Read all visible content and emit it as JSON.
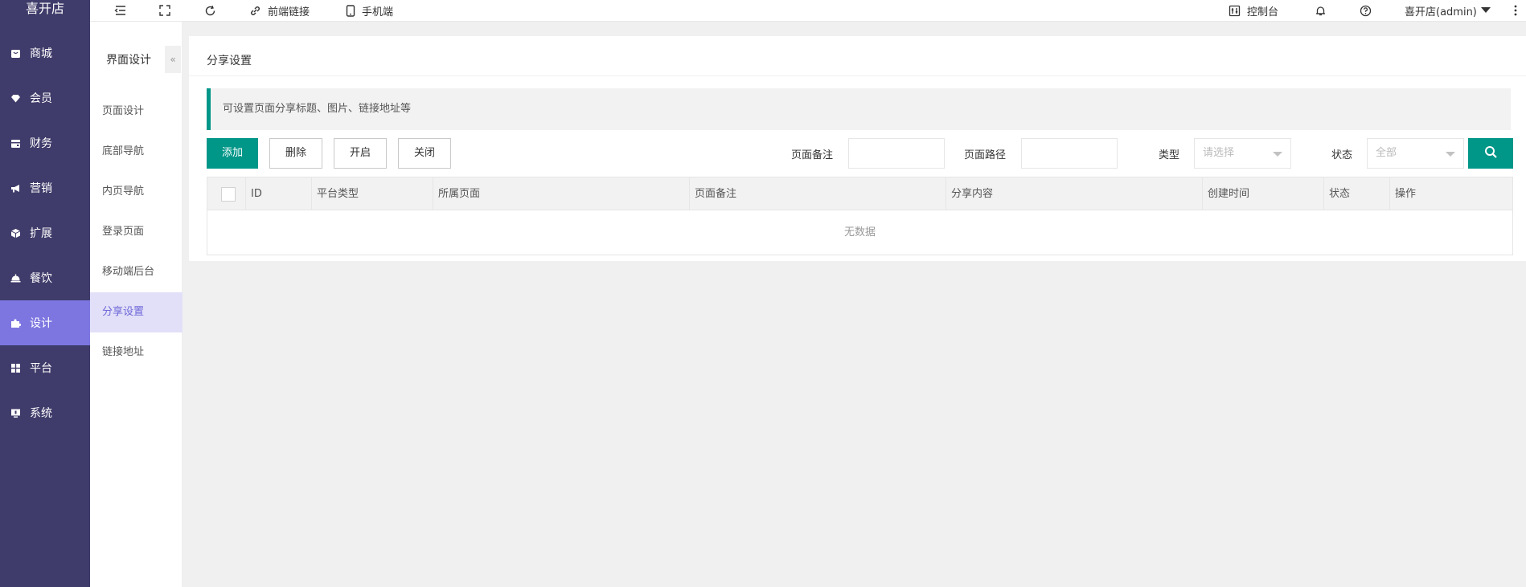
{
  "brand": "喜开店",
  "sidebar": {
    "items": [
      {
        "label": "商城",
        "icon": "shop-icon"
      },
      {
        "label": "会员",
        "icon": "diamond-icon"
      },
      {
        "label": "财务",
        "icon": "wallet-icon"
      },
      {
        "label": "营销",
        "icon": "megaphone-icon"
      },
      {
        "label": "扩展",
        "icon": "cube-icon"
      },
      {
        "label": "餐饮",
        "icon": "cloche-icon"
      },
      {
        "label": "设计",
        "icon": "puzzle-icon",
        "active": true
      },
      {
        "label": "平台",
        "icon": "grid-icon"
      },
      {
        "label": "系统",
        "icon": "monitor-icon"
      }
    ]
  },
  "subnav": {
    "title": "界面设计",
    "collapse_glyph": "«",
    "items": [
      {
        "label": "页面设计"
      },
      {
        "label": "底部导航"
      },
      {
        "label": "内页导航"
      },
      {
        "label": "登录页面"
      },
      {
        "label": "移动端后台"
      },
      {
        "label": "分享设置",
        "active": true
      },
      {
        "label": "链接地址"
      }
    ]
  },
  "topbar": {
    "frontend_link": "前端链接",
    "mobile": "手机端",
    "console": "控制台",
    "user": "喜开店(admin)"
  },
  "card": {
    "title": "分享设置",
    "tip": "可设置页面分享标题、图片、链接地址等"
  },
  "toolbar": {
    "add": "添加",
    "delete": "删除",
    "enable": "开启",
    "disable": "关闭"
  },
  "filters": {
    "remark_label": "页面备注",
    "remark_value": "",
    "path_label": "页面路径",
    "path_value": "",
    "type_label": "类型",
    "type_placeholder": "请选择",
    "status_label": "状态",
    "status_value": "全部"
  },
  "table": {
    "columns": [
      "ID",
      "平台类型",
      "所属页面",
      "页面备注",
      "分享内容",
      "创建时间",
      "状态",
      "操作"
    ],
    "empty_text": "无数据"
  },
  "colors": {
    "sidebar_bg": "#3f3b6a",
    "sidebar_active": "#7d76e0",
    "primary": "#009688",
    "subnav_active_bg": "#e2e0f8"
  }
}
